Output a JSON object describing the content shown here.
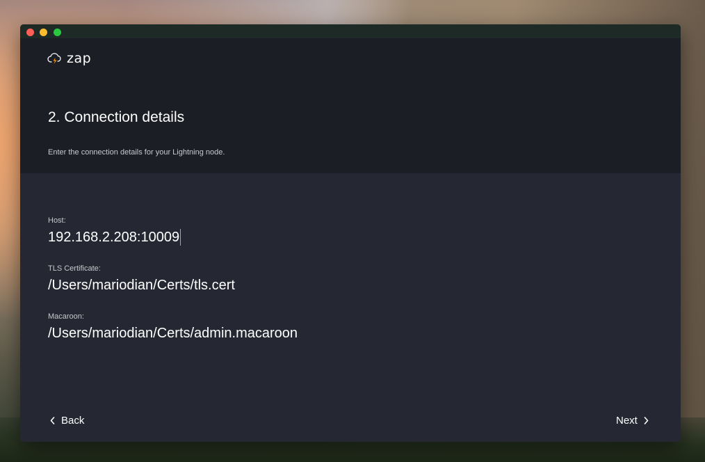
{
  "app": {
    "name": "zap",
    "brand_color": "#fd9800"
  },
  "header": {
    "step_title": "2. Connection details",
    "step_subtitle": "Enter the connection details for your Lightning node."
  },
  "form": {
    "host": {
      "label": "Host:",
      "value": "192.168.2.208:10009",
      "focused": true
    },
    "tls_certificate": {
      "label": "TLS Certificate:",
      "value": "/Users/mariodian/Certs/tls.cert"
    },
    "macaroon": {
      "label": "Macaroon:",
      "value": "/Users/mariodian/Certs/admin.macaroon"
    }
  },
  "navigation": {
    "back_label": "Back",
    "back_icon": "chevron-left-icon",
    "next_label": "Next",
    "next_icon": "chevron-right-icon"
  },
  "window_controls": {
    "close_color": "#fe5f57",
    "minimize_color": "#febc2e",
    "zoom_color": "#28c840"
  }
}
